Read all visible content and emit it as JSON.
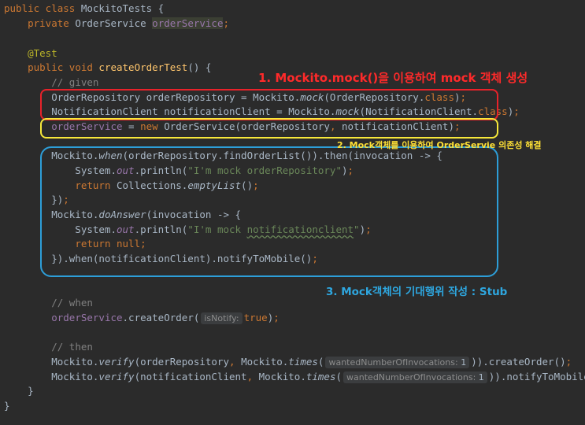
{
  "annotations": {
    "label1": "1. Mockito.mock()을 이용하여 mock 객체 생성",
    "label2": "2. Mock객체를 이용하여 OrderServie 의존성 해결",
    "label3": "3. Mock객체의 기대행위 작성 : Stub"
  },
  "hints": {
    "is_notify": "isNotify:",
    "wanted_invocations": "wantedNumberOfInvocations:",
    "wanted_value": "1"
  },
  "colors": {
    "background": "#2b2b2b",
    "keyword": "#cc7832",
    "string": "#6a8759",
    "field": "#9876aa",
    "method": "#ffc66d",
    "annotation_red": "#e8222a",
    "annotation_yellow": "#f7e83a",
    "annotation_blue": "#2d9ed8"
  }
}
